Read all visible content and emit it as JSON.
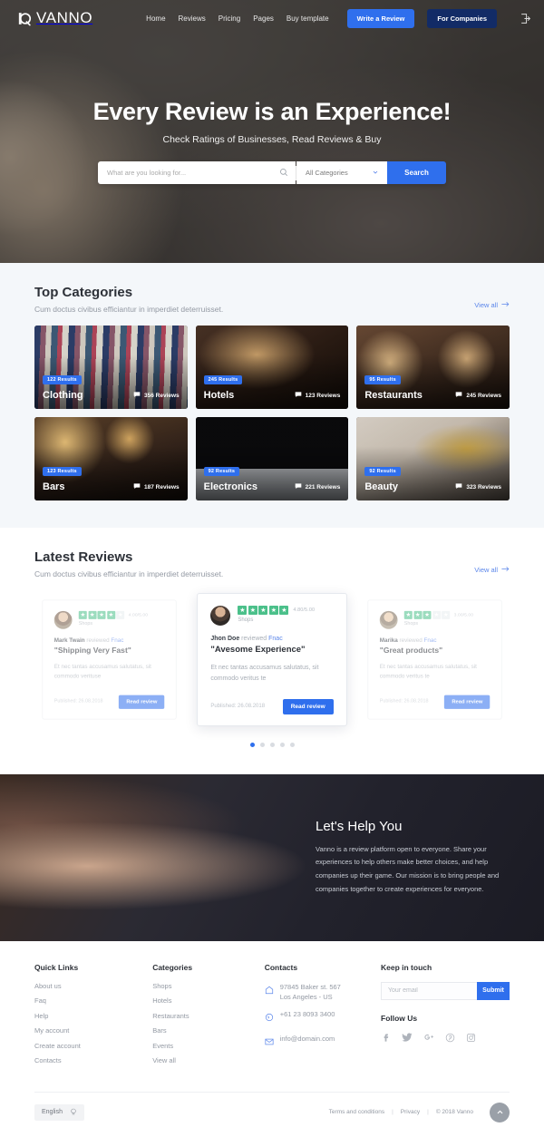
{
  "brand": {
    "name": "VANNO",
    "accent": "#2f6fed",
    "dark_accent": "#122b66"
  },
  "nav": {
    "links": [
      "Home",
      "Reviews",
      "Pricing",
      "Pages",
      "Buy template"
    ],
    "write_review": "Write a Review",
    "for_companies": "For Companies"
  },
  "hero": {
    "title": "Every Review is an Experience!",
    "subtitle": "Check Ratings of Businesses, Read Reviews & Buy",
    "search_placeholder": "What are you looking for...",
    "search_value": "",
    "category_selected": "All Categories",
    "search_button": "Search"
  },
  "categories_section": {
    "title": "Top Categories",
    "subtitle": "Cum doctus civibus efficiantur in imperdiet deterruisset.",
    "view_all": "View all",
    "cards": [
      {
        "name": "Clothing",
        "results": "122 Results",
        "reviews": "356 Reviews"
      },
      {
        "name": "Hotels",
        "results": "245 Results",
        "reviews": "123 Reviews"
      },
      {
        "name": "Restaurants",
        "results": "95 Results",
        "reviews": "245 Reviews"
      },
      {
        "name": "Bars",
        "results": "123 Results",
        "reviews": "187 Reviews"
      },
      {
        "name": "Electronics",
        "results": "92 Results",
        "reviews": "221 Reviews"
      },
      {
        "name": "Beauty",
        "results": "92 Results",
        "reviews": "323 Reviews"
      }
    ]
  },
  "reviews_section": {
    "title": "Latest Reviews",
    "subtitle": "Cum doctus civibus efficiantur in imperdiet deterruisset.",
    "view_all": "View all",
    "cards": [
      {
        "author": "Mark Twain",
        "action": "reviewed",
        "company": "Fnac",
        "rating_value": "4.00/5.00",
        "stars_on": 4,
        "stars_total": 5,
        "shop_label": "Shops",
        "title": "\"Shipping Very Fast\"",
        "body": "Et nec tantas accusamus salutatus, sit commodo verituse",
        "published": "Published: 26.08.2018",
        "read_button": "Read review"
      },
      {
        "author": "Jhon Doe",
        "action": "reviewed",
        "company": "Fnac",
        "rating_value": "4.80/5.00",
        "stars_on": 5,
        "stars_total": 5,
        "shop_label": "Shops",
        "title": "\"Avesome Experience\"",
        "body": "Et nec tantas accusamus salutatus, sit commodo veritus te",
        "published": "Published: 26.08.2018",
        "read_button": "Read review"
      },
      {
        "author": "Marika",
        "action": "reviewed",
        "company": "Fnac",
        "rating_value": "3.00/5.00",
        "stars_on": 3,
        "stars_total": 5,
        "shop_label": "Shops",
        "title": "\"Great products\"",
        "body": "Et nec tantas accusamus salutatus, sit commodo veritus te",
        "published": "Published: 26.08.2018",
        "read_button": "Read review"
      }
    ],
    "dots": 5,
    "active_dot": 0
  },
  "help": {
    "title": "Let's Help You",
    "text": "Vanno is a review platform open to everyone. Share your experiences to help others make better choices, and help companies up their game. Our mission is to bring people and companies together to create experiences for everyone."
  },
  "footer": {
    "quick_links": {
      "title": "Quick Links",
      "items": [
        "About us",
        "Faq",
        "Help",
        "My account",
        "Create account",
        "Contacts"
      ]
    },
    "categories": {
      "title": "Categories",
      "items": [
        "Shops",
        "Hotels",
        "Restaurants",
        "Bars",
        "Events",
        "View all"
      ]
    },
    "contacts": {
      "title": "Contacts",
      "address_line1": "97845 Baker st. 567",
      "address_line2": "Los Angeles - US",
      "phone": "+61 23 8093 3400",
      "email": "info@domain.com"
    },
    "keep_in_touch": {
      "title": "Keep in touch",
      "placeholder": "Your email",
      "value": "",
      "submit": "Submit"
    },
    "follow": {
      "title": "Follow Us",
      "networks": [
        "facebook-icon",
        "twitter-icon",
        "google-plus-icon",
        "pinterest-icon",
        "instagram-icon"
      ]
    },
    "bottom": {
      "language": "English",
      "terms": "Terms and conditions",
      "privacy": "Privacy",
      "copyright": "© 2018 Vanno",
      "sep": "|"
    }
  }
}
